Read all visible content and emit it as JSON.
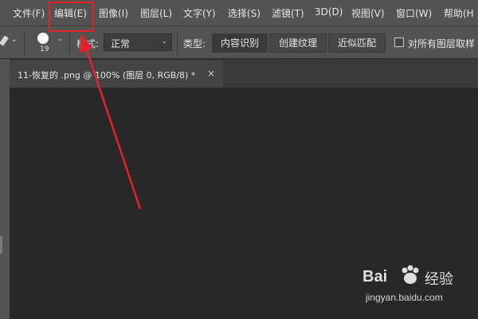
{
  "menu": {
    "items": [
      {
        "label": "文件(F)"
      },
      {
        "label": "编辑(E)"
      },
      {
        "label": "图像(I)"
      },
      {
        "label": "图层(L)"
      },
      {
        "label": "文字(Y)"
      },
      {
        "label": "选择(S)"
      },
      {
        "label": "滤镜(T)"
      },
      {
        "label": "3D(D)"
      },
      {
        "label": "视图(V)"
      },
      {
        "label": "窗口(W)"
      },
      {
        "label": "帮助(H"
      }
    ]
  },
  "options": {
    "brush_size": "19",
    "mode_label": "模式:",
    "mode_value": "正常",
    "type_label": "类型:",
    "type_options": [
      "内容识别",
      "创建纹理",
      "近似匹配"
    ],
    "type_selected": "内容识别",
    "sample_all_layers_label": "对所有图层取样"
  },
  "document": {
    "tab_title": "11-恢复的 .png @ 100% (图层 0, RGB/8) *",
    "close_symbol": "×"
  },
  "watermark": {
    "brand": "Bai",
    "brand_cn": "经验",
    "url": "jingyan.baidu.com"
  },
  "annotation": {
    "highlight_color": "#e8202a"
  }
}
